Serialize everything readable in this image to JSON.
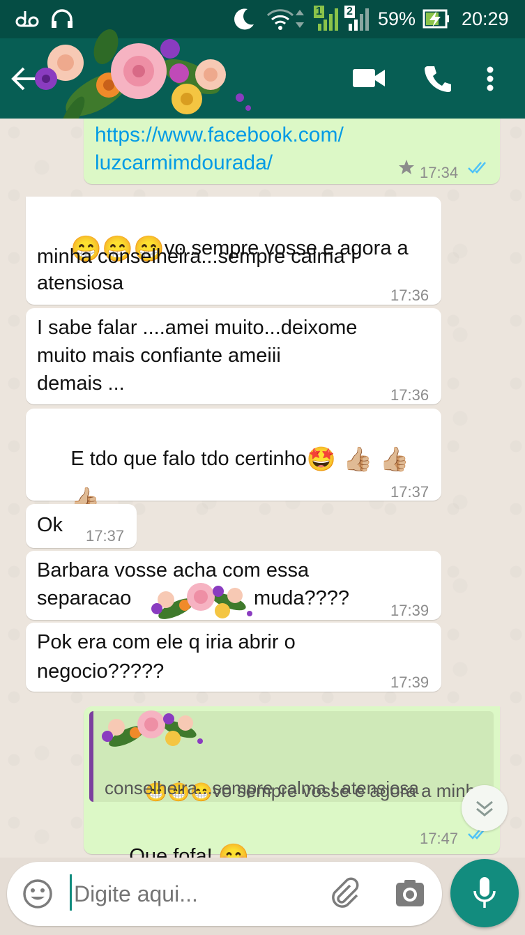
{
  "status_bar": {
    "battery": "59%",
    "time": "20:29",
    "sim1": "1",
    "sim2": "2"
  },
  "header": {
    "back_icon": "arrow-left-icon",
    "video_icon": "videocam-icon",
    "call_icon": "phone-icon",
    "menu_icon": "more-vert-icon"
  },
  "messages": [
    {
      "dir": "out",
      "lines": [
        "https://www.facebook.com/",
        "luzcarmimdourada/"
      ],
      "time": "17:34",
      "starred": true,
      "ticks": "read",
      "link": true
    },
    {
      "dir": "in",
      "emoji_prefix": [
        "😁",
        "😁",
        "😁"
      ],
      "lines": [
        "vo sempre vosse e agora a",
        "minha conselheira...sempre calma I",
        "atensiosa"
      ],
      "time": "17:36"
    },
    {
      "dir": "in",
      "lines": [
        "I sabe falar ....amei muito...deixome",
        "muito mais confiante ameiii",
        "demais ..."
      ],
      "time": "17:36"
    },
    {
      "dir": "in",
      "lines": [
        "E tdo que falo tdo certinho"
      ],
      "emoji_after": [
        "🤩",
        "👍🏼",
        "👍🏼"
      ],
      "emoji_line2": [
        "👍🏼"
      ],
      "time": "17:37"
    },
    {
      "dir": "in",
      "lines": [
        "Ok"
      ],
      "time": "17:37"
    },
    {
      "dir": "in",
      "lines": [
        "Barbara vosse acha com essa",
        "separacao",
        "muda????"
      ],
      "time": "17:39"
    },
    {
      "dir": "in",
      "lines": [
        "Pok era com ele q iria abrir o",
        "negocio?????"
      ],
      "time": "17:39"
    },
    {
      "dir": "out",
      "quote_emoji": [
        "😁",
        "😁",
        "😁"
      ],
      "quote_lines": [
        "vo sempre vosse e agora a minha",
        "conselheira...sempre calma I atensiosa"
      ],
      "lines": [
        "Que fofa!"
      ],
      "emoji_after": [
        "😊"
      ],
      "time": "17:47",
      "ticks": "read"
    }
  ],
  "composer": {
    "placeholder": "Digite aqui...",
    "emoji_icon": "smiley-icon",
    "attach_icon": "paperclip-icon",
    "camera_icon": "camera-icon",
    "mic_icon": "mic-icon"
  },
  "scroll_icon": "double-chevron-down-icon",
  "colors": {
    "header": "#075e54",
    "statusbar": "#054d44",
    "outgoing": "#dcf8c6",
    "incoming": "#ffffff",
    "tick": "#4fc3f7",
    "link": "#039be5",
    "fab": "#128c7e",
    "quote_bar": "#7b3f9e"
  }
}
